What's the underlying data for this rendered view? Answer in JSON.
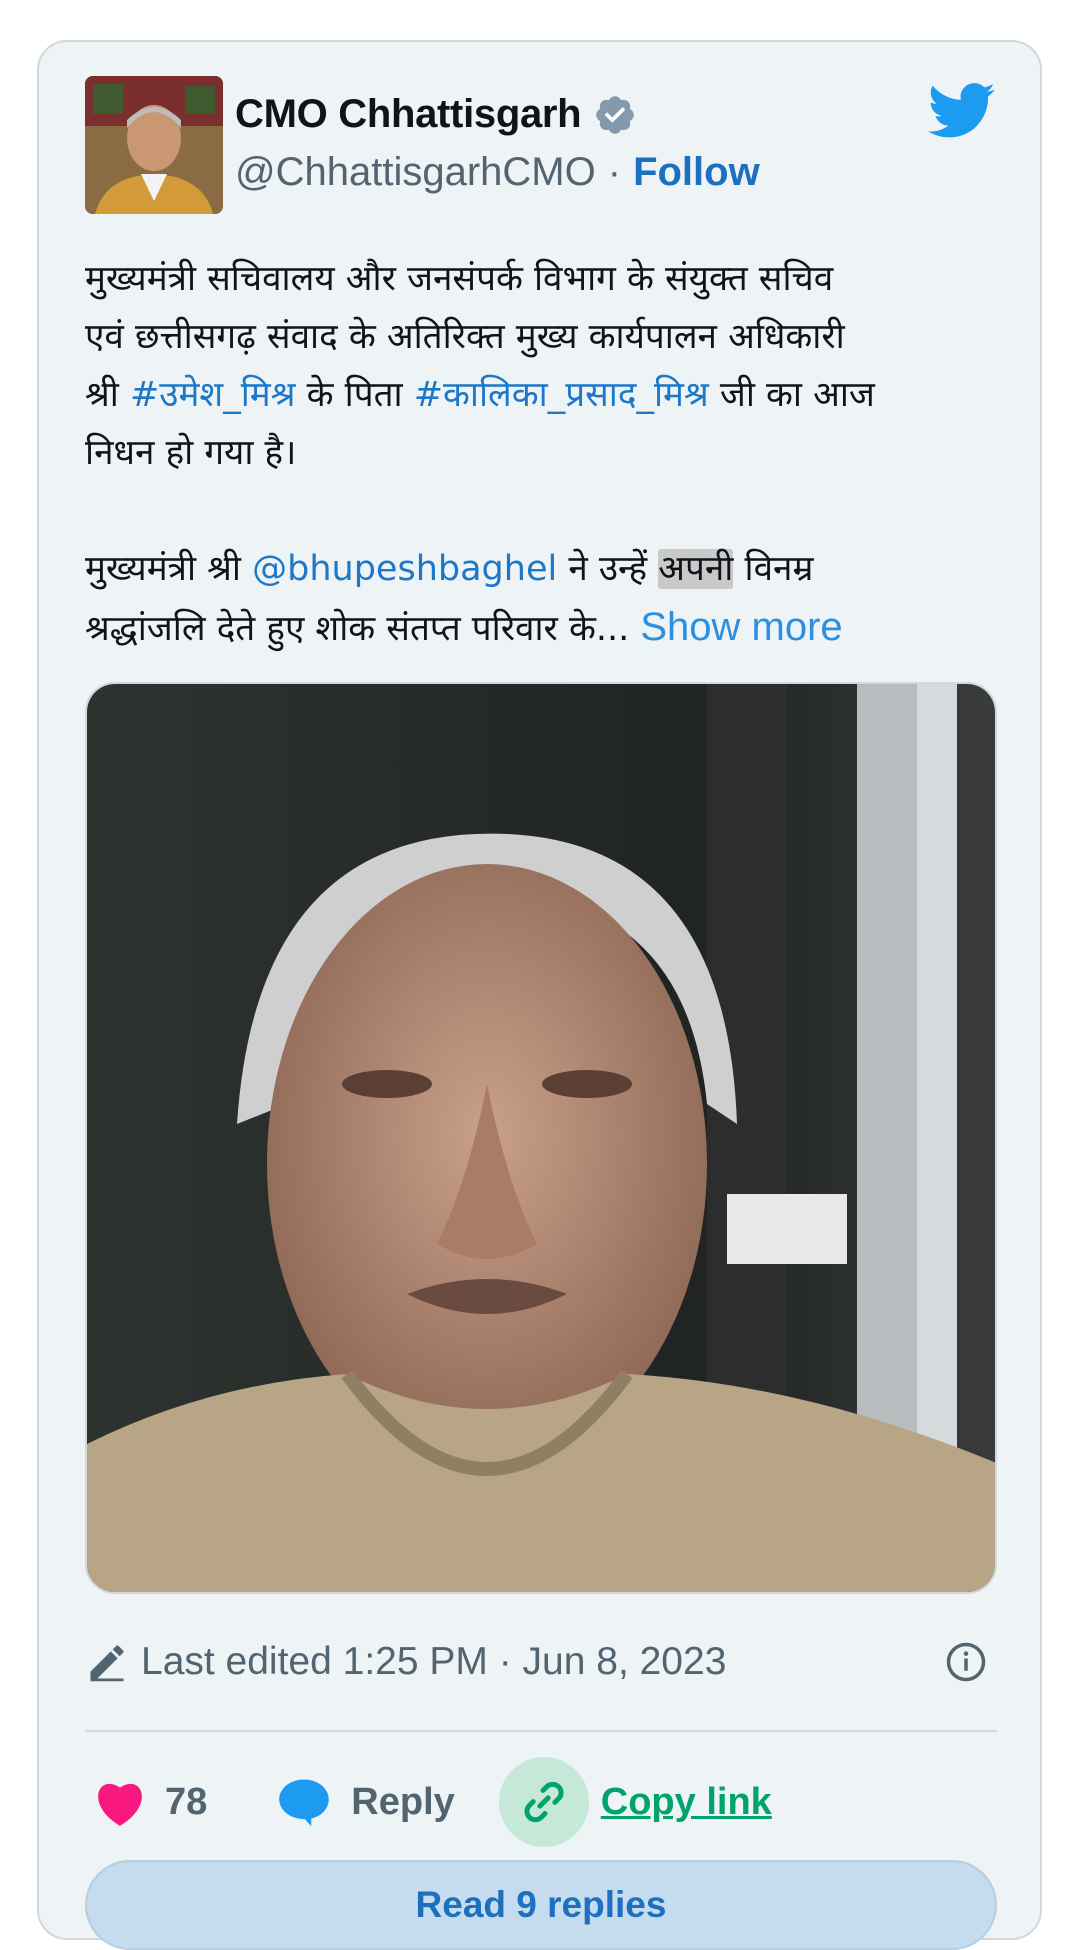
{
  "tweet": {
    "author_name": "CMO Chhattisgarh",
    "handle": "@ChhattisgarhCMO",
    "separator": "·",
    "follow_label": "Follow",
    "line1": "मुख्यमंत्री सचिवालय और जनसंपर्क विभाग के संयुक्त सचिव",
    "line2": "एवं छत्तीसगढ़ संवाद के अतिरिक्त मुख्य कार्यपालन अधिकारी",
    "line3_a": "श्री ",
    "hashtag1": "#उमेश_मिश्र",
    "line3_b": " के पिता ",
    "hashtag2": "#कालिका_प्रसाद_मिश्र",
    "line3_c": " जी का आज",
    "line4": "निधन हो गया है।",
    "line5_a": "मुख्यमंत्री श्री ",
    "mention": "@bhupeshbaghel",
    "line5_b": " ने उन्हें ",
    "highlighted_word": "अपनी",
    "line5_c": " विनम्र",
    "line6": "श्रद्धांजलि देते हुए शोक संतप्त परिवार के... ",
    "show_more": "Show more",
    "edited_text": "Last edited 1:25 PM · Jun 8, 2023",
    "like_count": "78",
    "reply_label": "Reply",
    "copy_link_label": "Copy link",
    "read_replies_label": "Read 9 replies"
  },
  "icons": {
    "verified": "verified-badge-icon",
    "twitter": "twitter-bird-icon",
    "edit": "pencil-icon",
    "info": "info-icon",
    "like": "heart-icon",
    "reply": "speech-bubble-icon",
    "copy": "link-icon"
  },
  "colors": {
    "card_bg": "#eef3f6",
    "link": "#1d78c8",
    "twitter_blue": "#1d9bf0",
    "heart": "#f91880",
    "copy_green": "#00a36c",
    "read_button_bg": "#c5dbee"
  }
}
